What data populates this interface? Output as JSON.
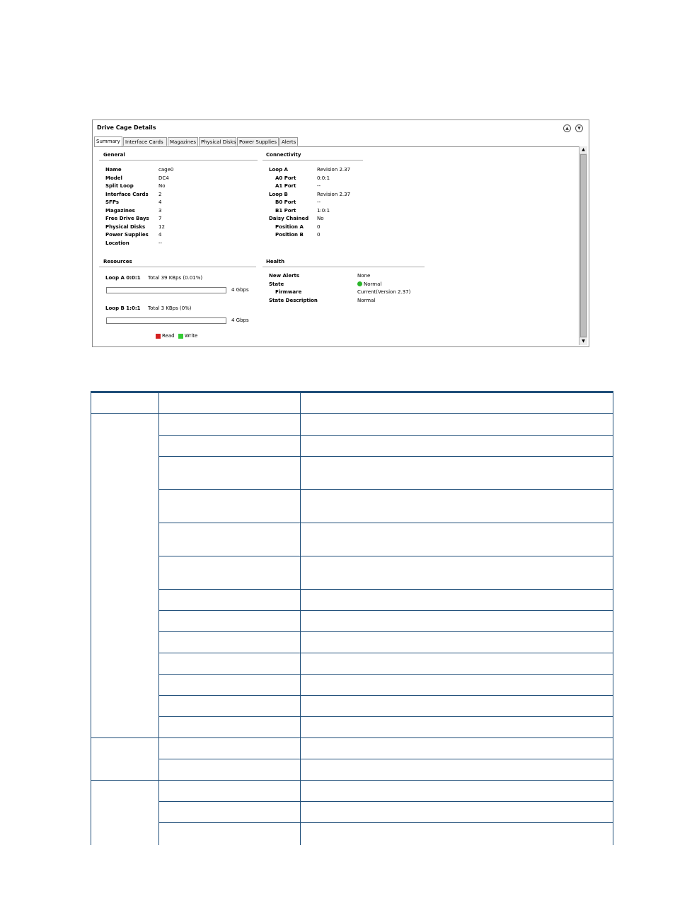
{
  "panel": {
    "title": "Drive Cage Details",
    "tabs": [
      "Summary",
      "Interface Cards",
      "Magazines",
      "Physical Disks",
      "Power Supplies",
      "Alerts"
    ],
    "active_tab": "Summary"
  },
  "general": {
    "title": "General",
    "rows": [
      {
        "k": "Name",
        "v": "cage0"
      },
      {
        "k": "Model",
        "v": "DC4"
      },
      {
        "k": "Split Loop",
        "v": "No"
      },
      {
        "k": "Interface Cards",
        "v": "2"
      },
      {
        "k": "SFPs",
        "v": "4"
      },
      {
        "k": "Magazines",
        "v": "3"
      },
      {
        "k": "Free Drive Bays",
        "v": "7"
      },
      {
        "k": "Physical Disks",
        "v": "12"
      },
      {
        "k": "Power Supplies",
        "v": "4"
      },
      {
        "k": "Location",
        "v": "--"
      }
    ]
  },
  "connectivity": {
    "title": "Connectivity",
    "rows": [
      {
        "k": "Loop A",
        "v": "Revision 2.37"
      },
      {
        "k": "A0 Port",
        "v": "0:0:1"
      },
      {
        "k": "A1 Port",
        "v": "--"
      },
      {
        "k": "Loop B",
        "v": "Revision 2.37"
      },
      {
        "k": "B0 Port",
        "v": "--"
      },
      {
        "k": "B1 Port",
        "v": "1:0:1"
      },
      {
        "k": "Daisy Chained",
        "v": "No"
      },
      {
        "k": "Position A",
        "v": "0"
      },
      {
        "k": "Position B",
        "v": "0"
      }
    ]
  },
  "resources": {
    "title": "Resources",
    "loop_a_label": "Loop A 0:0:1",
    "loop_a_total": "Total 39 KBps (0.01%)",
    "loop_a_speed": "4 Gbps",
    "loop_b_label": "Loop B 1:0:1",
    "loop_b_total": "Total 3 KBps (0%)",
    "loop_b_speed": "4 Gbps",
    "legend_read": "Read",
    "legend_write": "Write",
    "read_color": "#d42020",
    "write_color": "#33cc33"
  },
  "health": {
    "title": "Health",
    "new_alerts_k": "New Alerts",
    "new_alerts_v": "None",
    "state_k": "State",
    "state_v": "Normal",
    "firmware_k": "Firmware",
    "firmware_v": "Current(Version 2.37)",
    "state_desc_k": "State Description",
    "state_desc_v": "Normal",
    "state_color": "#2ab52a"
  },
  "table": {
    "row_heights": [
      30,
      30,
      47,
      47,
      47,
      47,
      30,
      30,
      30,
      30,
      30,
      30,
      30,
      30,
      30,
      30,
      30,
      30
    ]
  }
}
